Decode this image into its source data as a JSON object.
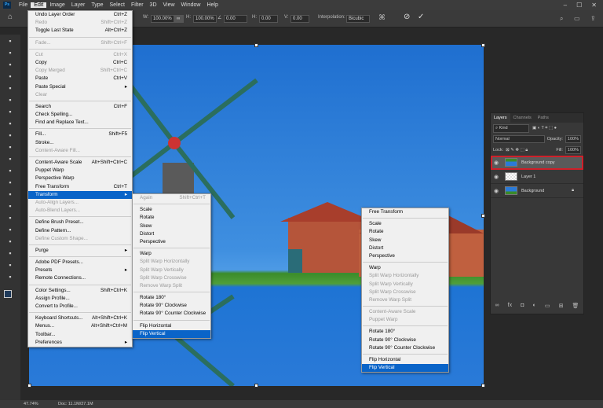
{
  "app": {
    "logo": "Ps",
    "menus": [
      "File",
      "Edit",
      "Image",
      "Layer",
      "Type",
      "Select",
      "Filter",
      "3D",
      "View",
      "Window",
      "Help"
    ],
    "active_menu": "Edit"
  },
  "window_controls": [
    "–",
    "☐",
    "✕"
  ],
  "options": {
    "w_label": "W:",
    "w_value": "100.00%",
    "h_label": "H:",
    "h_value": "100.00%",
    "angle_value": "0.00",
    "hskew_label": "H:",
    "hskew_value": "0.00",
    "vskew_label": "V:",
    "vskew_value": "0.00",
    "interp_label": "Interpolation:",
    "interp_value": "Bicubic"
  },
  "edit_menu": [
    [
      {
        "l": "Undo Layer Order",
        "s": "Ctrl+Z"
      },
      {
        "l": "Redo",
        "s": "Shift+Ctrl+Z",
        "d": 1
      },
      {
        "l": "Toggle Last State",
        "s": "Alt+Ctrl+Z"
      }
    ],
    [
      {
        "l": "Fade...",
        "s": "Shift+Ctrl+F",
        "d": 1
      }
    ],
    [
      {
        "l": "Cut",
        "s": "Ctrl+X",
        "d": 1
      },
      {
        "l": "Copy",
        "s": "Ctrl+C"
      },
      {
        "l": "Copy Merged",
        "s": "Shift+Ctrl+C",
        "d": 1
      },
      {
        "l": "Paste",
        "s": "Ctrl+V"
      },
      {
        "l": "Paste Special",
        "s": "▸"
      },
      {
        "l": "Clear",
        "s": "",
        "d": 1
      }
    ],
    [
      {
        "l": "Search",
        "s": "Ctrl+F"
      },
      {
        "l": "Check Spelling...",
        "s": ""
      },
      {
        "l": "Find and Replace Text...",
        "s": ""
      }
    ],
    [
      {
        "l": "Fill...",
        "s": "Shift+F5"
      },
      {
        "l": "Stroke...",
        "s": ""
      },
      {
        "l": "Content-Aware Fill...",
        "s": "",
        "d": 1
      }
    ],
    [
      {
        "l": "Content-Aware Scale",
        "s": "Alt+Shift+Ctrl+C"
      },
      {
        "l": "Puppet Warp",
        "s": ""
      },
      {
        "l": "Perspective Warp",
        "s": ""
      },
      {
        "l": "Free Transform",
        "s": "Ctrl+T"
      },
      {
        "l": "Transform",
        "s": "▸",
        "sel": 1
      },
      {
        "l": "Auto-Align Layers...",
        "s": "",
        "d": 1
      },
      {
        "l": "Auto-Blend Layers...",
        "s": "",
        "d": 1
      }
    ],
    [
      {
        "l": "Define Brush Preset...",
        "s": ""
      },
      {
        "l": "Define Pattern...",
        "s": ""
      },
      {
        "l": "Define Custom Shape...",
        "s": "",
        "d": 1
      }
    ],
    [
      {
        "l": "Purge",
        "s": "▸"
      }
    ],
    [
      {
        "l": "Adobe PDF Presets...",
        "s": ""
      },
      {
        "l": "Presets",
        "s": "▸"
      },
      {
        "l": "Remote Connections...",
        "s": ""
      }
    ],
    [
      {
        "l": "Color Settings...",
        "s": "Shift+Ctrl+K"
      },
      {
        "l": "Assign Profile...",
        "s": ""
      },
      {
        "l": "Convert to Profile...",
        "s": ""
      }
    ],
    [
      {
        "l": "Keyboard Shortcuts...",
        "s": "Alt+Shift+Ctrl+K"
      },
      {
        "l": "Menus...",
        "s": "Alt+Shift+Ctrl+M"
      },
      {
        "l": "Toolbar...",
        "s": ""
      },
      {
        "l": "Preferences",
        "s": "▸"
      }
    ]
  ],
  "transform_menu": [
    [
      {
        "l": "Again",
        "s": "Shift+Ctrl+T",
        "d": 1
      }
    ],
    [
      {
        "l": "Scale",
        "s": ""
      },
      {
        "l": "Rotate",
        "s": ""
      },
      {
        "l": "Skew",
        "s": ""
      },
      {
        "l": "Distort",
        "s": ""
      },
      {
        "l": "Perspective",
        "s": ""
      }
    ],
    [
      {
        "l": "Warp",
        "s": ""
      },
      {
        "l": "Split Warp Horizontally",
        "s": "",
        "d": 1
      },
      {
        "l": "Split Warp Vertically",
        "s": "",
        "d": 1
      },
      {
        "l": "Split Warp Crosswise",
        "s": "",
        "d": 1
      },
      {
        "l": "Remove Warp Split",
        "s": "",
        "d": 1
      }
    ],
    [
      {
        "l": "Rotate 180°",
        "s": ""
      },
      {
        "l": "Rotate 90° Clockwise",
        "s": ""
      },
      {
        "l": "Rotate 90° Counter Clockwise",
        "s": ""
      }
    ],
    [
      {
        "l": "Flip Horizontal",
        "s": ""
      },
      {
        "l": "Flip Vertical",
        "s": "",
        "sel": 1
      }
    ]
  ],
  "callout_menu": [
    [
      {
        "l": "Free Transform",
        "s": ""
      }
    ],
    [
      {
        "l": "Scale",
        "s": ""
      },
      {
        "l": "Rotate",
        "s": ""
      },
      {
        "l": "Skew",
        "s": ""
      },
      {
        "l": "Distort",
        "s": ""
      },
      {
        "l": "Perspective",
        "s": ""
      }
    ],
    [
      {
        "l": "Warp",
        "s": ""
      },
      {
        "l": "Split Warp Horizontally",
        "s": "",
        "d": 1
      },
      {
        "l": "Split Warp Vertically",
        "s": "",
        "d": 1
      },
      {
        "l": "Split Warp Crosswise",
        "s": "",
        "d": 1
      },
      {
        "l": "Remove Warp Split",
        "s": "",
        "d": 1
      }
    ],
    [
      {
        "l": "Content-Aware Scale",
        "s": "",
        "d": 1
      },
      {
        "l": "Puppet Warp",
        "s": "",
        "d": 1
      }
    ],
    [
      {
        "l": "Rotate 180°",
        "s": ""
      },
      {
        "l": "Rotate 90° Clockwise",
        "s": ""
      },
      {
        "l": "Rotate 90° Counter Clockwise",
        "s": ""
      }
    ],
    [
      {
        "l": "Flip Horizontal",
        "s": ""
      },
      {
        "l": "Flip Vertical",
        "s": "",
        "sel": 1
      }
    ]
  ],
  "layers_panel": {
    "tabs": [
      "Layers",
      "Channels",
      "Paths"
    ],
    "filter": "Kind",
    "blend": "Normal",
    "opacity_label": "Opacity:",
    "opacity": "100%",
    "lock_label": "Lock:",
    "fill_label": "Fill:",
    "fill": "100%",
    "layers": [
      {
        "name": "Background copy",
        "selected": true
      },
      {
        "name": "Layer 1"
      },
      {
        "name": "Background",
        "locked": true
      }
    ]
  },
  "status": {
    "zoom": "47.74%",
    "doc": "Doc: 11.1M/27.1M"
  },
  "colors": {
    "highlight": "#0a64c8",
    "layer_outline": "#d0202a"
  }
}
